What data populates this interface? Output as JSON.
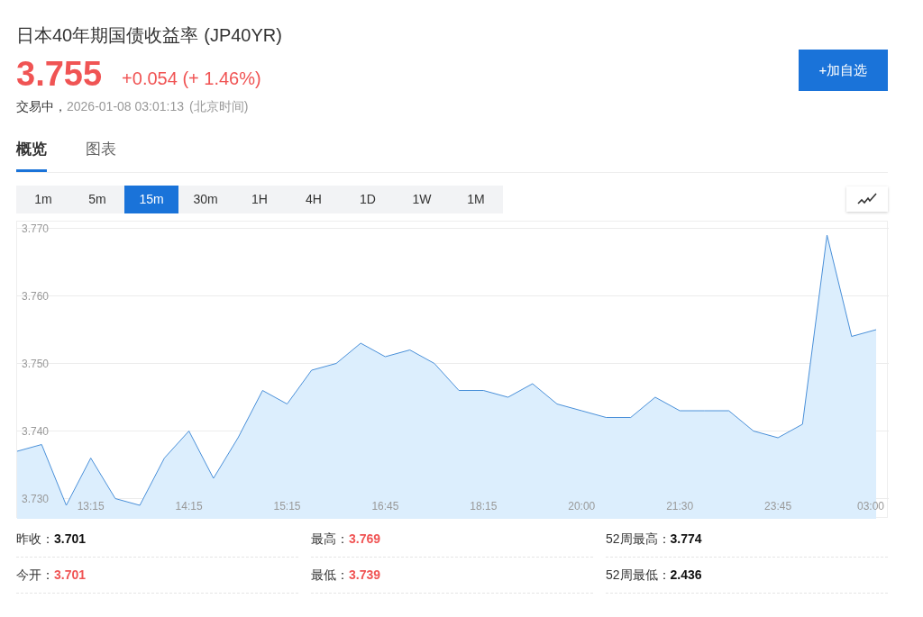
{
  "header": {
    "title": "日本40年期国债收益率",
    "code": "(JP40YR)",
    "price": "3.755",
    "change": "+0.054 (+ 1.46%)",
    "status": "交易中，",
    "time": "2026-01-08 03:01:13",
    "timezone": "(北京时间)",
    "add_button": "+加自选"
  },
  "tabs": [
    {
      "label": "概览",
      "selected": true
    },
    {
      "label": "图表",
      "selected": false
    }
  ],
  "periods": [
    {
      "label": "1m",
      "selected": false
    },
    {
      "label": "5m",
      "selected": false
    },
    {
      "label": "15m",
      "selected": true
    },
    {
      "label": "30m",
      "selected": false
    },
    {
      "label": "1H",
      "selected": false
    },
    {
      "label": "4H",
      "selected": false
    },
    {
      "label": "1D",
      "selected": false
    },
    {
      "label": "1W",
      "selected": false
    },
    {
      "label": "1M",
      "selected": false
    }
  ],
  "chart": {
    "chart_data": {
      "type": "area",
      "ylim": [
        3.727,
        3.771
      ],
      "yticks": [
        {
          "value": 3.73,
          "label": "3.730"
        },
        {
          "value": 3.74,
          "label": "3.740"
        },
        {
          "value": 3.75,
          "label": "3.750"
        },
        {
          "value": 3.76,
          "label": "3.760"
        },
        {
          "value": 3.77,
          "label": "3.770"
        }
      ],
      "grid": true,
      "categories": [
        null,
        null,
        null,
        "13:15",
        null,
        null,
        null,
        "14:15",
        null,
        null,
        null,
        "15:15",
        null,
        null,
        null,
        "16:45",
        null,
        null,
        null,
        "18:15",
        null,
        null,
        null,
        "20:00",
        null,
        null,
        null,
        "21:30",
        null,
        null,
        null,
        "23:45",
        null,
        null,
        null,
        "03:00"
      ],
      "series": [
        {
          "color": "#4a90d9",
          "values": [
            3.737,
            3.738,
            3.729,
            3.736,
            3.73,
            3.729,
            3.736,
            3.74,
            3.733,
            3.739,
            3.746,
            3.744,
            3.749,
            3.75,
            3.753,
            3.751,
            3.752,
            3.75,
            3.746,
            3.746,
            3.745,
            3.747,
            3.744,
            3.743,
            3.742,
            3.742,
            3.745,
            3.743,
            3.743,
            3.743,
            3.74,
            3.739,
            3.741,
            3.769,
            3.754,
            3.755
          ]
        }
      ]
    }
  },
  "stats": [
    {
      "label": "昨收：",
      "value": "3.701",
      "up": false
    },
    {
      "label": "最高：",
      "value": "3.769",
      "up": true
    },
    {
      "label": "52周最高：",
      "value": "3.774",
      "up": false
    },
    {
      "label": "今开：",
      "value": "3.701",
      "up": true
    },
    {
      "label": "最低：",
      "value": "3.739",
      "up": true
    },
    {
      "label": "52周最低：",
      "value": "2.436",
      "up": false
    }
  ]
}
